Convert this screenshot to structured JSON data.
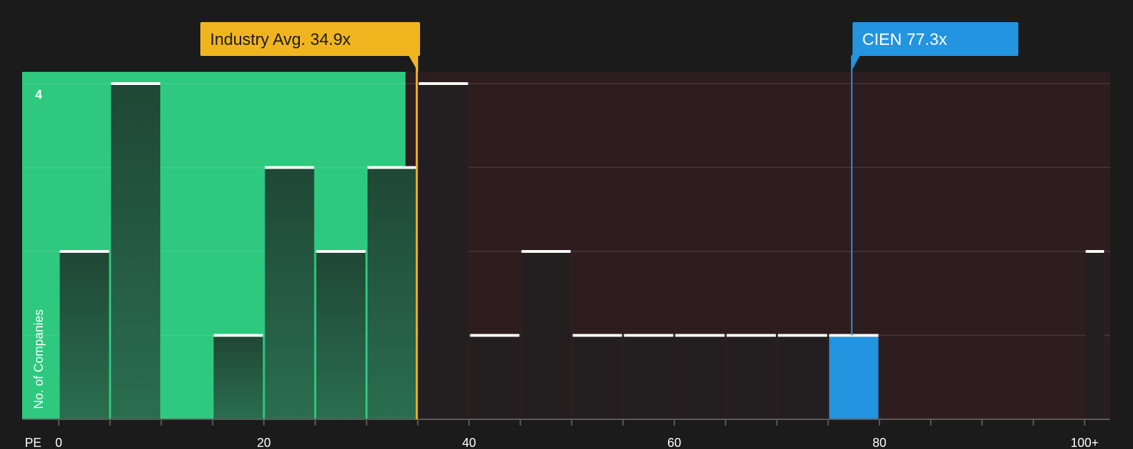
{
  "chart_data": {
    "type": "bar",
    "xlabel": "PE",
    "ylabel": "No. of Companies",
    "xlim": [
      0,
      102
    ],
    "ylim": [
      0,
      4
    ],
    "x_ticks": [
      0,
      20,
      40,
      60,
      80,
      100
    ],
    "x_tick_labels": [
      "0",
      "20",
      "40",
      "60",
      "80",
      "100+"
    ],
    "y_tick_labels_shown": [
      4
    ],
    "grid": true,
    "bins": [
      {
        "start": 0,
        "end": 5,
        "value": 2
      },
      {
        "start": 5,
        "end": 10,
        "value": 4
      },
      {
        "start": 15,
        "end": 20,
        "value": 1
      },
      {
        "start": 20,
        "end": 25,
        "value": 3
      },
      {
        "start": 25,
        "end": 30,
        "value": 2
      },
      {
        "start": 30,
        "end": 35,
        "value": 3
      },
      {
        "start": 35,
        "end": 40,
        "value": 4
      },
      {
        "start": 40,
        "end": 45,
        "value": 1
      },
      {
        "start": 45,
        "end": 50,
        "value": 2
      },
      {
        "start": 50,
        "end": 55,
        "value": 1
      },
      {
        "start": 55,
        "end": 60,
        "value": 1
      },
      {
        "start": 60,
        "end": 65,
        "value": 1
      },
      {
        "start": 65,
        "end": 70,
        "value": 1
      },
      {
        "start": 70,
        "end": 75,
        "value": 1
      },
      {
        "start": 75,
        "end": 80,
        "value": 1,
        "highlight": true
      },
      {
        "start": 100,
        "end": 102,
        "value": 2
      }
    ],
    "fair_range": {
      "start": 0,
      "end": 33.8
    },
    "annotations": [
      {
        "label": "Industry Avg. 34.9x",
        "value": 34.9,
        "color": "#f0b51e",
        "text_color": "#1b1b1b"
      },
      {
        "label": "CIEN 77.3x",
        "value": 77.3,
        "color": "#2394e0",
        "text_color": "#ffffff"
      }
    ]
  },
  "colors": {
    "background": "#1b1b1b",
    "fair_zone": "#2ec97e",
    "over_zone": "#2e1d1f",
    "bar_in_fair": "#1f4a37",
    "bar_default": "#231f20",
    "bar_highlight": "#2394e0",
    "bar_cap": "#ffffff"
  }
}
